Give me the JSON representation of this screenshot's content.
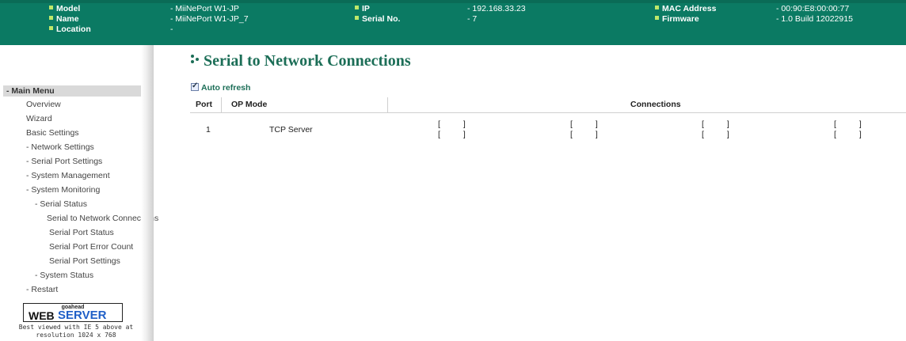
{
  "info_bar": {
    "row1": [
      {
        "label": "Model",
        "value": "- MiiNePort W1-JP"
      },
      {
        "label": "IP",
        "value": "- 192.168.33.23"
      },
      {
        "label": "MAC Address",
        "value": "- 00:90:E8:00:00:77"
      }
    ],
    "row2": [
      {
        "label": "Name",
        "value": "- MiiNePort W1-JP_7"
      },
      {
        "label": "Serial No.",
        "value": "- 7"
      },
      {
        "label": "Firmware",
        "value": "- 1.0 Build 12022915"
      }
    ],
    "row3": [
      {
        "label": "Location",
        "value": "-"
      }
    ]
  },
  "sidebar": {
    "header": "- Main Menu",
    "items": [
      "Overview",
      "Wizard",
      "Basic Settings",
      "- Network Settings",
      "- Serial Port Settings",
      "- System Management",
      "- System Monitoring",
      "- Serial Status",
      "Serial to Network Connections",
      "Serial Port Status",
      "Serial Port Error Count",
      "Serial Port Settings",
      "- System Status",
      "- Restart"
    ],
    "logo": {
      "top": "goahead",
      "web": "WEB",
      "server": "SERVER"
    },
    "note_line1": "Best viewed with IE 5 above at",
    "note_line2": "resolution 1024 x 768"
  },
  "main": {
    "title": "Serial to Network Connections",
    "auto_refresh_label": "Auto refresh",
    "auto_refresh_checked": true,
    "table": {
      "headers": [
        "Port",
        "OP Mode",
        "Connections"
      ],
      "rows": [
        {
          "port": "1",
          "op_mode": "TCP Server",
          "connections": [
            "[ ]",
            "[ ]",
            "[ ]",
            "[ ]",
            "[ ]",
            "[ ]",
            "[ ]",
            "[ ]"
          ]
        }
      ]
    }
  },
  "colors": {
    "topbar": "#0b7a63",
    "accent": "#1c6e57",
    "bullet": "#bfe86a"
  }
}
